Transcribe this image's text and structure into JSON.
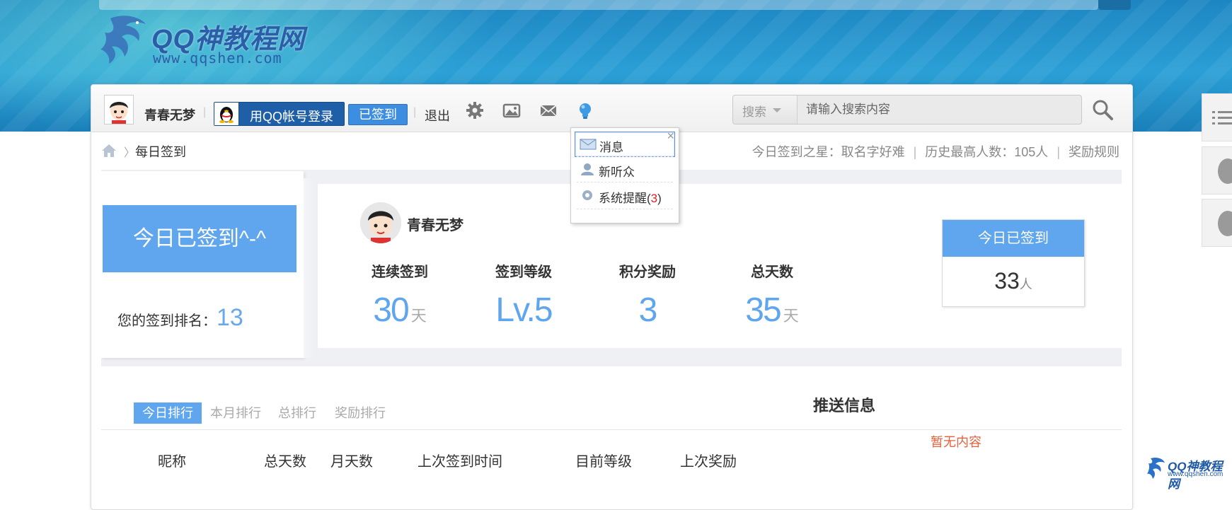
{
  "site": {
    "logo_name": "QQ神教程网",
    "logo_url": "www.qqshen.com"
  },
  "nav": {
    "username": "青春无梦",
    "qq_login_label": "用QQ帐号登录",
    "signed_label": "已签到",
    "logout_label": "退出",
    "separator": "|"
  },
  "search": {
    "type_label": "搜索",
    "placeholder": "请输入搜索内容"
  },
  "breadcrumb": {
    "current": "每日签到",
    "arrow": "〉"
  },
  "top_info": {
    "star_label": "今日签到之星：",
    "star_name": "取名字好难",
    "max_label": "历史最高人数：",
    "max_value": "105人",
    "rules_label": "奖励规则"
  },
  "sign_panel": {
    "today_signed_label": "今日已签到^-^",
    "rank_label": "您的签到排名：",
    "rank_value": "13",
    "username": "青春无梦",
    "stats": [
      {
        "label": "连续签到",
        "value": "30",
        "unit": "天"
      },
      {
        "label": "签到等级",
        "value": "Lv.5",
        "unit": ""
      },
      {
        "label": "积分奖励",
        "value": "3",
        "unit": ""
      },
      {
        "label": "总天数",
        "value": "35",
        "unit": "天"
      }
    ],
    "today_count_header": "今日已签到",
    "today_count_value": "33",
    "today_count_unit": "人"
  },
  "popup": {
    "items": [
      {
        "label": "消息"
      },
      {
        "label": "新听众"
      },
      {
        "label": "系统提醒(",
        "count": "3",
        "suffix": ")"
      }
    ],
    "close": "×"
  },
  "tabs": [
    {
      "label": "今日排行"
    },
    {
      "label": "本月排行"
    },
    {
      "label": "总排行"
    },
    {
      "label": "奖励排行"
    }
  ],
  "push": {
    "title": "推送信息",
    "empty": "暂无内容"
  },
  "table": {
    "headers": [
      "昵称",
      "总天数",
      "月天数",
      "上次签到时间",
      "目前等级",
      "上次奖励"
    ]
  },
  "bottom_logo": {
    "name": "QQ神教程网",
    "url": "www.qqshen.com"
  },
  "colors": {
    "accent_blue": "#5fa6ee",
    "banner_blue": "#1d86c2",
    "notice_red": "#e8603c"
  }
}
